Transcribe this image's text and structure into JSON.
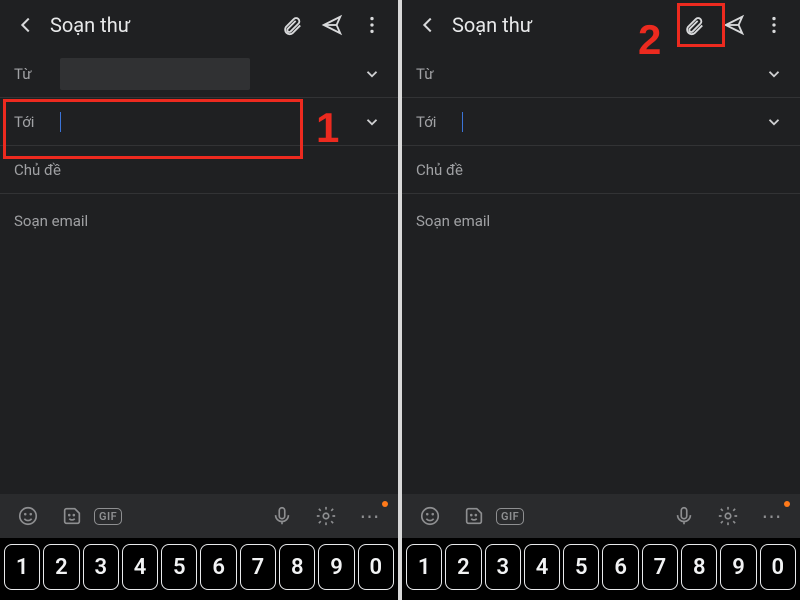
{
  "annotations": {
    "step1": "1",
    "step2": "2",
    "color": "#ec2a1f"
  },
  "left": {
    "header": {
      "title": "Soạn thư"
    },
    "from": {
      "label": "Từ"
    },
    "to": {
      "label": "Tới"
    },
    "subject": {
      "placeholder": "Chủ đề"
    },
    "body": {
      "placeholder": "Soạn email"
    },
    "suggest": {
      "gif": "GIF",
      "more": "⋯"
    },
    "keys": [
      "1",
      "2",
      "3",
      "4",
      "5",
      "6",
      "7",
      "8",
      "9",
      "0"
    ]
  },
  "right": {
    "header": {
      "title": "Soạn thư"
    },
    "from": {
      "label": "Từ"
    },
    "to": {
      "label": "Tới"
    },
    "subject": {
      "placeholder": "Chủ đề"
    },
    "body": {
      "placeholder": "Soạn email"
    },
    "suggest": {
      "gif": "GIF",
      "more": "⋯"
    },
    "keys": [
      "1",
      "2",
      "3",
      "4",
      "5",
      "6",
      "7",
      "8",
      "9",
      "0"
    ]
  }
}
